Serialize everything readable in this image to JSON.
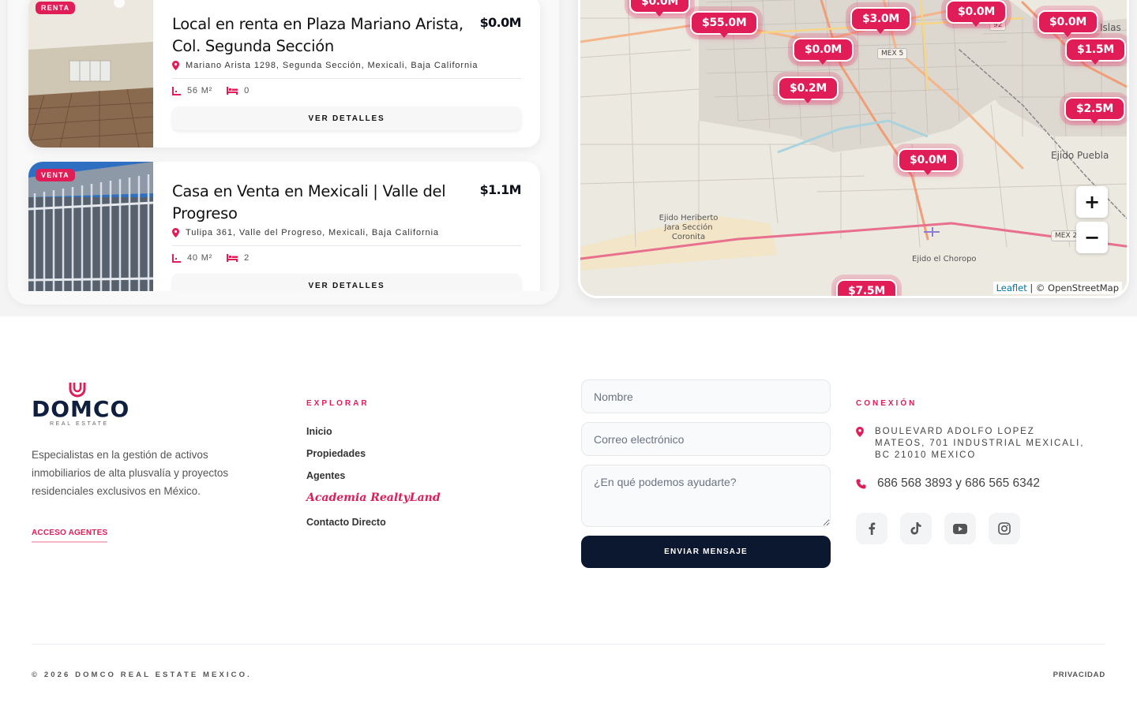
{
  "listings": [
    {
      "badge": "RENTA",
      "title": "Local en renta en Plaza Mariano Arista, Col. Segunda Sección",
      "price": "$0.0M",
      "address": "Mariano Arista 1298, Segunda Sección, Mexicali, Baja California",
      "area": "56 M²",
      "bedrooms": "0",
      "button": "VER DETALLES"
    },
    {
      "badge": "VENTA",
      "title": "Casa en Venta en Mexicali | Valle del Progreso",
      "price": "$1.1M",
      "address": "Tulipa 361, Valle del Progreso, Mexicali, Baja California",
      "area": "40 M²",
      "bedrooms": "2",
      "button": "VER DETALLES"
    }
  ],
  "map": {
    "markers": [
      "$55.0M",
      "$3.0M",
      "$0.0M",
      "$0.0M",
      "$1.5M",
      "$0.0M",
      "$0.2M",
      "$2.5M",
      "$0.0M",
      "$7.5M"
    ],
    "place_labels": {
      "islas": "Islas",
      "ejido_puebla": "Ejido Puebla",
      "ejido_heriberto": "Ejido Heriberto Jara Sección Coronita",
      "ejido_choropo": "Ejido el Choropo"
    },
    "road_shields": {
      "mex5": "MEX 5",
      "mex2": "MEX 2",
      "r92": "92"
    },
    "zoom_in": "+",
    "zoom_out": "−",
    "attribution_link": "Leaflet",
    "attribution_text": "| © OpenStreetMap"
  },
  "footer": {
    "brand_name": "DOMCO",
    "brand_sub": "REAL ESTATE",
    "description": "Especialistas en la gestión de activos inmobiliarios de alta plusvalía y proyectos residenciales exclusivos en México.",
    "agent_link": "ACCESO AGENTES",
    "explore_heading": "EXPLORAR",
    "nav": [
      "Inicio",
      "Propiedades",
      "Agentes",
      "Academia RealtyLand",
      "Contacto Directo"
    ],
    "form": {
      "name_placeholder": "Nombre",
      "email_placeholder": "Correo electrónico",
      "message_placeholder": "¿En qué podemos ayudarte?",
      "submit": "ENVIAR MENSAJE"
    },
    "connect_heading": "CONEXIÓN",
    "address": "BOULEVARD ADOLFO LOPEZ MATEOS, 701 INDUSTRIAL MEXICALI, BC 21010 MEXICO",
    "phone": "686 568 3893 y 686 565 6342",
    "social_icons": [
      "facebook-icon",
      "tiktok-icon",
      "youtube-icon",
      "instagram-icon"
    ],
    "copyright": "© 2026 DOMCO REAL ESTATE MEXICO.",
    "privacy": "PRIVACIDAD"
  },
  "colors": {
    "accent": "#e11d58",
    "navy": "#0c1730"
  }
}
